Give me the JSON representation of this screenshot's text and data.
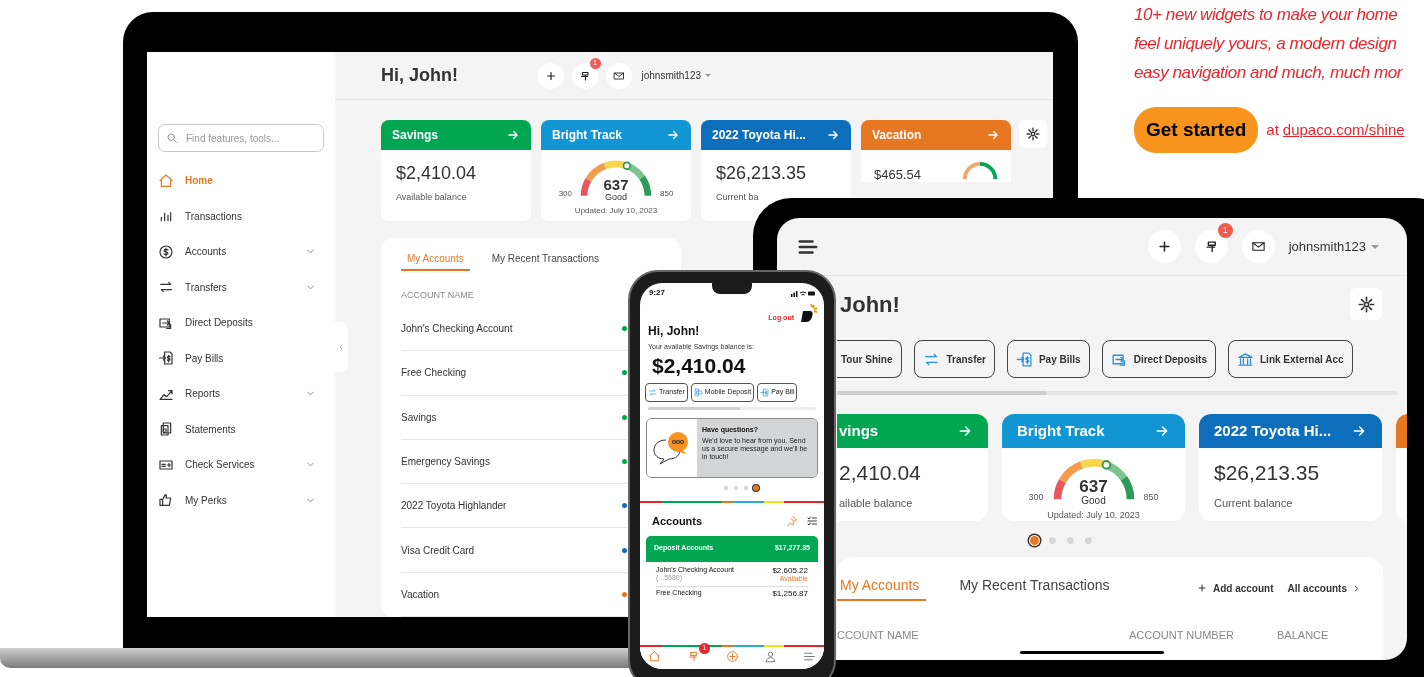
{
  "promo": {
    "headline": [
      "10+ new widgets to make your home",
      "feel uniquely yours, a modern design",
      "easy navigation and much, much mor"
    ],
    "cta": "Get started",
    "cta_prefix": "at",
    "link": "dupaco.com/shine"
  },
  "laptop": {
    "search_placeholder": "Find features, tools...",
    "nav": [
      {
        "label": "Home",
        "selected": true,
        "expandable": false
      },
      {
        "label": "Transactions",
        "selected": false,
        "expandable": false
      },
      {
        "label": "Accounts",
        "selected": false,
        "expandable": true
      },
      {
        "label": "Transfers",
        "selected": false,
        "expandable": true
      },
      {
        "label": "Direct Deposits",
        "selected": false,
        "expandable": false
      },
      {
        "label": "Pay Bills",
        "selected": false,
        "expandable": false
      },
      {
        "label": "Reports",
        "selected": false,
        "expandable": true
      },
      {
        "label": "Statements",
        "selected": false,
        "expandable": false
      },
      {
        "label": "Check Services",
        "selected": false,
        "expandable": true
      },
      {
        "label": "My Perks",
        "selected": false,
        "expandable": true
      }
    ],
    "greeting": "Hi, John!",
    "notification_count": "1",
    "username": "johnsmith123",
    "widgets": [
      {
        "kind": "balance",
        "title": "Savings",
        "color": "#00a651",
        "amount": "$2,410.04",
        "caption": "Available balance"
      },
      {
        "kind": "score",
        "title": "Bright Track",
        "color": "#1196d3",
        "score": "637",
        "rating": "Good",
        "min": "300",
        "max": "850",
        "level": 0.61,
        "updated": "Updated: July 10, 2023"
      },
      {
        "kind": "balance",
        "title": "2022 Toyota Hi...",
        "color": "#0d6ebc",
        "amount": "$26,213.35",
        "caption": "Current ba"
      },
      {
        "kind": "goal",
        "title": "Vacation",
        "color": "#e87722",
        "amount": "$465.54"
      }
    ],
    "tabs": [
      {
        "label": "My Accounts",
        "selected": true
      },
      {
        "label": "My Recent Transactions",
        "selected": false
      }
    ],
    "columns": [
      "ACCOUNT NAME"
    ],
    "accounts": [
      {
        "name": "John's Checking Account",
        "color": "#00a651"
      },
      {
        "name": "Free Checking",
        "color": "#00a651"
      },
      {
        "name": "Savings",
        "color": "#00a651"
      },
      {
        "name": "Emergency Savings",
        "color": "#00a651"
      },
      {
        "name": "2022 Toyota Highlander",
        "color": "#0d6ebc"
      },
      {
        "name": "Visa Credit Card",
        "color": "#0d6ebc"
      },
      {
        "name": "Vacation",
        "color": "#e87722"
      }
    ]
  },
  "tablet": {
    "notification_count": "1",
    "username": "johnsmith123",
    "greeting": "John!",
    "actions": [
      "Tour Shine",
      "Transfer",
      "Pay Bills",
      "Direct Deposits",
      "Link External Acc"
    ],
    "widgets": [
      {
        "kind": "balance",
        "title": "vings",
        "color": "#00a651",
        "amount": "2,410.04",
        "caption": "ailable balance"
      },
      {
        "kind": "score",
        "title": "Bright Track",
        "color": "#1196d3",
        "score": "637",
        "rating": "Good",
        "min": "300",
        "max": "850",
        "level": 0.61,
        "updated": "Updated: July 10, 2023"
      },
      {
        "kind": "balance",
        "title": "2022 Toyota Hi...",
        "color": "#0d6ebc",
        "amount": "$26,213.35",
        "caption": "Current balance"
      },
      {
        "kind": "edge",
        "color": "#e87722"
      }
    ],
    "carousel": [
      {
        "selected": true
      },
      {
        "selected": false
      },
      {
        "selected": false
      },
      {
        "selected": false
      }
    ],
    "tabs": [
      {
        "label": "My Accounts",
        "selected": true
      },
      {
        "label": "My Recent Transactions",
        "selected": false
      }
    ],
    "add_account": "Add account",
    "all_accounts": "All accounts",
    "columns": [
      "CCOUNT NAME",
      "ACCOUNT NUMBER",
      "BALANCE"
    ]
  },
  "phone": {
    "time": "9:27",
    "logout": "Log out",
    "greeting": "Hi, John!",
    "balance_label": "Your available Savings balance is:",
    "balance": "$2,410.04",
    "actions": [
      "Transfer",
      "Mobile Deposit",
      "Pay Bill"
    ],
    "promo": {
      "title": "Have questions?",
      "body": "We'd love to hear from you. Send us a secure message and we'll be in touch!"
    },
    "carousel": [
      {
        "selected": false
      },
      {
        "selected": false
      },
      {
        "selected": false
      },
      {
        "selected": true
      }
    ],
    "accounts_title": "Accounts",
    "group": {
      "name": "Deposit Accounts",
      "total": "$17,277.35"
    },
    "accounts": [
      {
        "name": "John's Checking Account",
        "number": "(...5580)",
        "amount": "$2,605.22",
        "status": "Available"
      },
      {
        "name": "Free Checking",
        "amount": "$1,256.87"
      }
    ],
    "nav_badge": "1"
  }
}
